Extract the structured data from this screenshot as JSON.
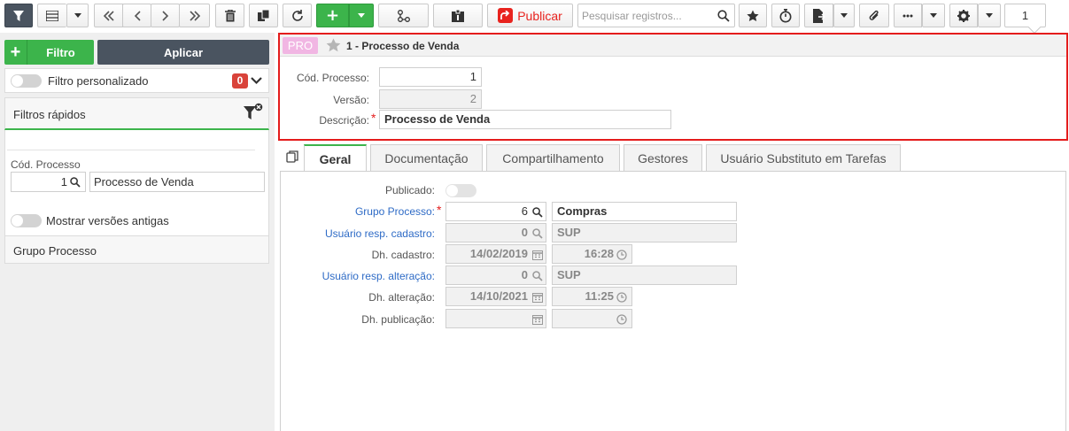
{
  "toolbar": {
    "search_placeholder": "Pesquisar registros...",
    "publish_label": "Publicar",
    "page_number": "1",
    "icons": [
      "filter-icon",
      "list-view-icon",
      "dropdown-icon",
      "first-page-icon",
      "prev-page-icon",
      "next-page-icon",
      "last-page-icon",
      "delete-icon",
      "copy-icon",
      "refresh-icon",
      "add-icon",
      "workflow-icon",
      "id-card-icon",
      "publish-icon",
      "search-icon",
      "star-icon",
      "timer-icon",
      "export-icon",
      "attachment-icon",
      "more-icon",
      "settings-icon"
    ]
  },
  "left_panel": {
    "filter_button": "Filtro",
    "apply_button": "Aplicar",
    "custom_filter_label": "Filtro personalizado",
    "custom_filter_count": "0",
    "quick_filters_title": "Filtros rápidos",
    "process_code_label": "Cód. Processo",
    "process_code_value": "1",
    "process_name_value": "Processo de Venda",
    "old_versions_label": "Mostrar versões antigas",
    "group_process_title": "Grupo Processo"
  },
  "record_header": {
    "tag": "PRO",
    "title": "1 - Processo de Venda",
    "fields": {
      "code_label": "Cód. Processo:",
      "code_value": "1",
      "version_label": "Versão:",
      "version_value": "2",
      "description_label": "Descrição:",
      "description_value": "Processo de Venda"
    }
  },
  "tabs": [
    "Geral",
    "Documentação",
    "Compartilhamento",
    "Gestores",
    "Usuário Substituto em Tarefas"
  ],
  "general": {
    "published_label": "Publicado:",
    "group_label": "Grupo Processo:",
    "group_code": "6",
    "group_name": "Compras",
    "created_by_label": "Usuário resp. cadastro:",
    "created_by_code": "0",
    "created_by_name": "SUP",
    "created_at_label": "Dh. cadastro:",
    "created_date": "14/02/2019",
    "created_time": "16:28",
    "changed_by_label": "Usuário resp. alteração:",
    "changed_by_code": "0",
    "changed_by_name": "SUP",
    "changed_at_label": "Dh. alteração:",
    "changed_date": "14/10/2021",
    "changed_time": "11:25",
    "published_at_label": "Dh. publicação:",
    "published_date": "",
    "published_time": ""
  },
  "colors": {
    "accent_green": "#3cb44b",
    "dark_button": "#4a5460",
    "highlight_red": "#e41c1c",
    "badge_red": "#d9433a",
    "tag_pink": "#f1b6e3",
    "link_blue": "#2e6bc6"
  }
}
